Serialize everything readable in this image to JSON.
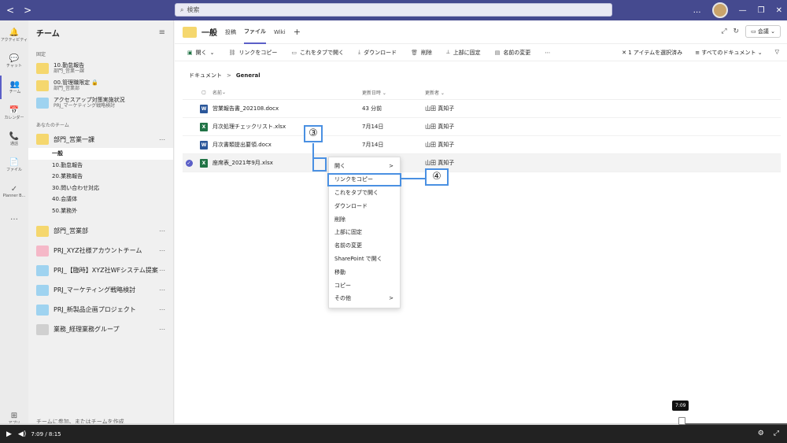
{
  "titlebar": {
    "back": "<",
    "forward": ">",
    "search_placeholder": "検索",
    "more": "…",
    "minimize": "—",
    "restore": "❐",
    "close": "✕"
  },
  "rail": [
    {
      "icon": "🔔",
      "label": "アクティビティ"
    },
    {
      "icon": "💬",
      "label": "チャット"
    },
    {
      "icon": "👥",
      "label": "チーム"
    },
    {
      "icon": "📅",
      "label": "カレンダー"
    },
    {
      "icon": "📞",
      "label": "通話"
    },
    {
      "icon": "📄",
      "label": "ファイル"
    },
    {
      "icon": "✓",
      "label": "Planner B..."
    },
    {
      "icon": "…",
      "label": ""
    }
  ],
  "rail_apps": {
    "icon": "⊞",
    "label": "アプリ"
  },
  "teams": {
    "title": "チーム",
    "pinned_label": "固定",
    "pinned": [
      {
        "name": "10.勤怠報告",
        "sub": "部門_営業一課"
      },
      {
        "name": "00.管理職限定",
        "sub": "部門_営業部"
      },
      {
        "name": "アクセスアップ対策実施状況",
        "sub": "PRJ_マーケティング戦略検討"
      }
    ],
    "your_teams_label": "あなたのチーム",
    "team1": "部門_営業一課",
    "channels": [
      "一般",
      "10.勤怠報告",
      "20.業務報告",
      "30.問い合わせ対応",
      "40.会議体",
      "50.業務外"
    ],
    "others": [
      "部門_営業部",
      "PRJ_XYZ社様アカウントチーム",
      "PRJ_【臨時】XYZ社WFシステム提案",
      "PRJ_マーケティング戦略検討",
      "PRJ_新製品企画プロジェクト",
      "業務_経理業務グループ"
    ],
    "footer": "チームに参加、またはチームを作成"
  },
  "channel": {
    "title": "一般",
    "tabs": [
      "投稿",
      "ファイル",
      "Wiki"
    ],
    "meet": "会議"
  },
  "toolbar": {
    "open": "開く",
    "copy_link": "リンクをコピー",
    "add_tab": "これをタブで開く",
    "download": "ダウンロード",
    "delete": "削除",
    "pin": "上部に固定",
    "rename": "名前の変更",
    "more": "⋯",
    "selected": "1 アイテムを選択済み",
    "all_docs": "すべてのドキュメント"
  },
  "breadcrumb": {
    "root": "ドキュメント",
    "current": "General"
  },
  "table": {
    "headers": {
      "name": "名前",
      "modified": "更新日時",
      "modified_by": "更新者"
    },
    "rows": [
      {
        "name": "営業報告書_202108.docx",
        "modified": "43 分前",
        "by": "山田 真知子",
        "type": "word"
      },
      {
        "name": "月次処理チェックリスト.xlsx",
        "modified": "7月14日",
        "by": "山田 真知子",
        "type": "excel"
      },
      {
        "name": "月次書類提出要領.docx",
        "modified": "7月14日",
        "by": "山田 真知子",
        "type": "word"
      },
      {
        "name": "座席表_2021年9月.xlsx",
        "modified": "7月14日",
        "by": "山田 真知子",
        "type": "excel"
      }
    ]
  },
  "context_menu": [
    "開く",
    "リンクをコピー",
    "これをタブで開く",
    "ダウンロード",
    "削除",
    "上部に固定",
    "名前の変更",
    "SharePoint で開く",
    "移動",
    "コピー",
    "その他"
  ],
  "markers": {
    "m3": "③",
    "m4": "④"
  },
  "player": {
    "current": "7:09",
    "total": "8:15",
    "tooltip": "7:09",
    "progress": 0.867
  }
}
